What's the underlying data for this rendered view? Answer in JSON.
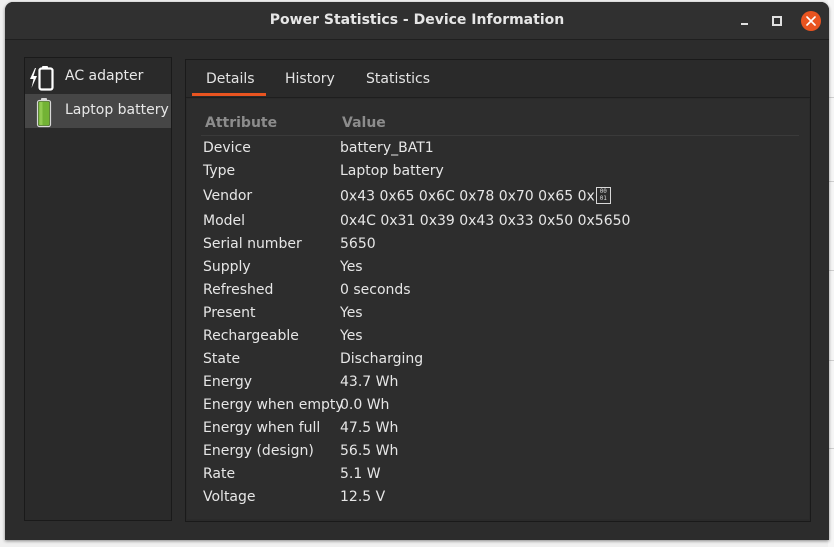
{
  "window": {
    "title": "Power Statistics - Device Information"
  },
  "devices": [
    {
      "label": "AC adapter",
      "icon": "ac-adapter-icon",
      "selected": false
    },
    {
      "label": "Laptop battery",
      "icon": "battery-icon",
      "selected": true
    }
  ],
  "tabs": [
    {
      "label": "Details",
      "active": true
    },
    {
      "label": "History",
      "active": false
    },
    {
      "label": "Statistics",
      "active": false
    }
  ],
  "table": {
    "headers": {
      "attribute": "Attribute",
      "value": "Value"
    },
    "rows": [
      {
        "attribute": "Device",
        "value": "battery_BAT1"
      },
      {
        "attribute": "Type",
        "value": "Laptop battery"
      },
      {
        "attribute": "Vendor",
        "value": "0x43 0x65 0x6C 0x78 0x70 0x65 0x"
      },
      {
        "attribute": "Model",
        "value": "0x4C 0x31 0x39 0x43 0x33 0x50 0x5650"
      },
      {
        "attribute": "Serial number",
        "value": "5650"
      },
      {
        "attribute": "Supply",
        "value": "Yes"
      },
      {
        "attribute": "Refreshed",
        "value": "0 seconds"
      },
      {
        "attribute": "Present",
        "value": "Yes"
      },
      {
        "attribute": "Rechargeable",
        "value": "Yes"
      },
      {
        "attribute": "State",
        "value": "Discharging"
      },
      {
        "attribute": "Energy",
        "value": "43.7 Wh"
      },
      {
        "attribute": "Energy when empty",
        "value": "0.0 Wh"
      },
      {
        "attribute": "Energy when full",
        "value": "47.5 Wh"
      },
      {
        "attribute": "Energy (design)",
        "value": "56.5 Wh"
      },
      {
        "attribute": "Rate",
        "value": "5.1 W"
      },
      {
        "attribute": "Voltage",
        "value": "12.5 V"
      }
    ],
    "vendor_unprintable_glyph": {
      "top": "00",
      "bottom": "01"
    }
  },
  "colors": {
    "accent": "#e95420",
    "battery_fill": "#73b335",
    "text": "#e6e6e6",
    "header_text": "#8c8c8c"
  }
}
